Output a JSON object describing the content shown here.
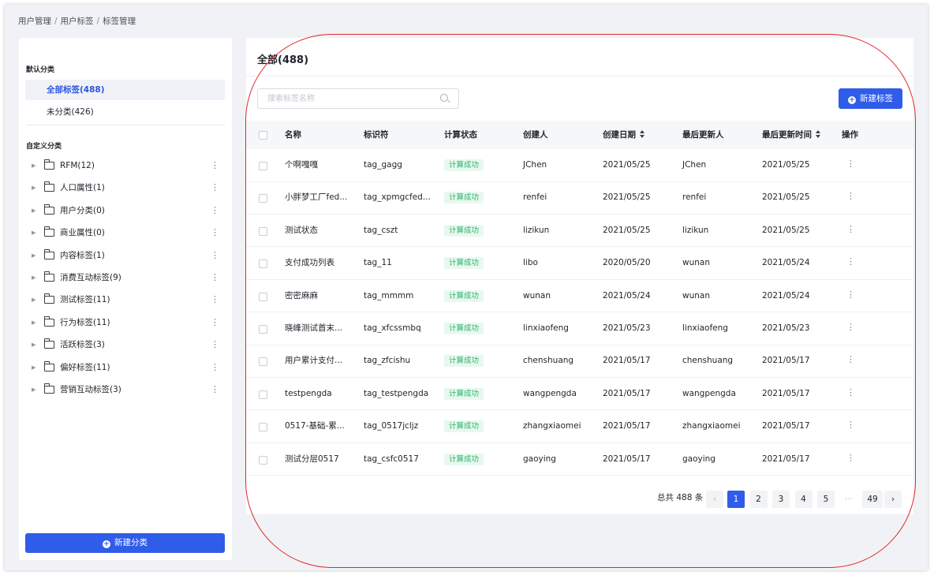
{
  "breadcrumb": [
    "用户管理",
    "用户标签",
    "标签管理"
  ],
  "sidebar": {
    "default_section": "默认分类",
    "default_items": [
      {
        "label": "全部标签(488)",
        "active": true
      },
      {
        "label": "未分类(426)",
        "active": false
      }
    ],
    "custom_section": "自定义分类",
    "custom_items": [
      {
        "label": "RFM(12)"
      },
      {
        "label": "人口属性(1)"
      },
      {
        "label": "用户分类(0)"
      },
      {
        "label": "商业属性(0)"
      },
      {
        "label": "内容标签(1)"
      },
      {
        "label": "消费互动标签(9)"
      },
      {
        "label": "测试标签(11)"
      },
      {
        "label": "行为标签(11)"
      },
      {
        "label": "活跃标签(3)"
      },
      {
        "label": "偏好标签(11)"
      },
      {
        "label": "营销互动标签(3)"
      }
    ],
    "new_category_button": "新建分类"
  },
  "main": {
    "title": "全部(488)",
    "search_placeholder": "搜索标签名称",
    "new_tag_button": "新建标签",
    "columns": [
      "名称",
      "标识符",
      "计算状态",
      "创建人",
      "创建日期",
      "最后更新人",
      "最后更新时间",
      "操作"
    ],
    "rows": [
      {
        "name": "个啊嘎嘎",
        "identifier": "tag_gagg",
        "status": "计算成功",
        "creator": "JChen",
        "created": "2021/05/25",
        "updater": "JChen",
        "updated": "2021/05/25"
      },
      {
        "name": "小胖梦工厂fed...",
        "identifier": "tag_xpmgcfed...",
        "status": "计算成功",
        "creator": "renfei",
        "created": "2021/05/25",
        "updater": "renfei",
        "updated": "2021/05/25"
      },
      {
        "name": "测试状态",
        "identifier": "tag_cszt",
        "status": "计算成功",
        "creator": "lizikun",
        "created": "2021/05/25",
        "updater": "lizikun",
        "updated": "2021/05/25"
      },
      {
        "name": "支付成功列表",
        "identifier": "tag_11",
        "status": "计算成功",
        "creator": "libo",
        "created": "2020/05/20",
        "updater": "wunan",
        "updated": "2021/05/24"
      },
      {
        "name": "密密麻麻",
        "identifier": "tag_mmmm",
        "status": "计算成功",
        "creator": "wunan",
        "created": "2021/05/24",
        "updater": "wunan",
        "updated": "2021/05/24"
      },
      {
        "name": "晓峰测试首末...",
        "identifier": "tag_xfcssmbq",
        "status": "计算成功",
        "creator": "linxiaofeng",
        "created": "2021/05/23",
        "updater": "linxiaofeng",
        "updated": "2021/05/23"
      },
      {
        "name": "用户累计支付...",
        "identifier": "tag_zfcishu",
        "status": "计算成功",
        "creator": "chenshuang",
        "created": "2021/05/17",
        "updater": "chenshuang",
        "updated": "2021/05/17"
      },
      {
        "name": "testpengda",
        "identifier": "tag_testpengda",
        "status": "计算成功",
        "creator": "wangpengda",
        "created": "2021/05/17",
        "updater": "wangpengda",
        "updated": "2021/05/17"
      },
      {
        "name": "0517-基础-累...",
        "identifier": "tag_0517jcljz",
        "status": "计算成功",
        "creator": "zhangxiaomei",
        "created": "2021/05/17",
        "updater": "zhangxiaomei",
        "updated": "2021/05/17"
      },
      {
        "name": "测试分层0517",
        "identifier": "tag_csfc0517",
        "status": "计算成功",
        "creator": "gaoying",
        "created": "2021/05/17",
        "updater": "gaoying",
        "updated": "2021/05/17"
      }
    ],
    "pagination": {
      "total_text": "总共 488 条",
      "pages": [
        "1",
        "2",
        "3",
        "4",
        "5"
      ],
      "ellipsis": "···",
      "last_page": "49",
      "current": "1"
    }
  },
  "colors": {
    "primary": "#2f5ce8",
    "success": "#2bb56a",
    "annotation": "#e1282c"
  }
}
